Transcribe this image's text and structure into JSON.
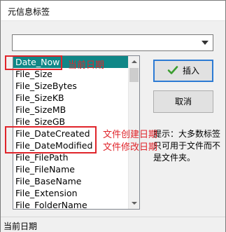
{
  "window": {
    "title": "元信息标签"
  },
  "dropdown": {
    "value": ""
  },
  "tag_list": {
    "items": [
      "Date_Now",
      "File_Size",
      "File_SizeBytes",
      "File_SizeKB",
      "File_SizeMB",
      "File_SizeGB",
      "File_DateCreated",
      "File_DateModified",
      "File_FilePath",
      "File_FileName",
      "File_BaseName",
      "File_Extension",
      "File_FolderName"
    ],
    "selected_index": 0
  },
  "buttons": {
    "insert_label": "插入",
    "cancel_label": "取消"
  },
  "hint": "提示：大多数标签只可用于文件而不是文件夹。",
  "annotations": {
    "date_now": "当前日期",
    "date_created": "文件创建日期",
    "date_modified": "文件修改日期"
  },
  "statusbar": {
    "text": "当前日期"
  },
  "colors": {
    "selection": "#0f8787",
    "annotation": "#e0252b",
    "ok_border": "#2d7bd4",
    "check_icon": "#3a9d2f"
  }
}
